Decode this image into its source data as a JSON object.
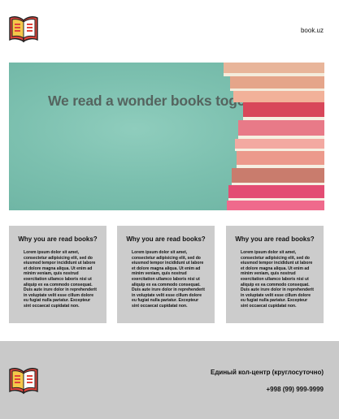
{
  "header": {
    "site_link": "book.uz",
    "logo_icon": "open-book-icon"
  },
  "hero": {
    "title": "We read a wonder books together..."
  },
  "cards": [
    {
      "title": "Why you are read books?",
      "text": "Lorem ipsum dolor sit amet, consectetur adipisicing elit, sed do eiusmod tempor incididunt ut labore et dolore magna aliqua. Ut enim ad minim veniam, quis nostrud exercitation ullamco laboris nisi ut aliquip ex ea commodo consequat. Duis aute irure dolor in reprehenderit in voluptate velit esse cillum dolore eu fugiat nulla pariatur. Excepteur sint occaecat cupidatat non."
    },
    {
      "title": "Why you are read books?",
      "text": "Lorem ipsum dolor sit amet, consectetur adipisicing elit, sed do eiusmod tempor incididunt ut labore et dolore magna aliqua. Ut enim ad minim veniam, quis nostrud exercitation ullamco laboris nisi ut aliquip ex ea commodo consequat. Duis aute irure dolor in reprehenderit in voluptate velit esse cillum dolore eu fugiat nulla pariatur. Excepteur sint occaecat cupidatat non."
    },
    {
      "title": "Why you are read books?",
      "text": "Lorem ipsum dolor sit amet, consectetur adipisicing elit, sed do eiusmod tempor incididunt ut labore et dolore magna aliqua. Ut enim ad minim veniam, quis nostrud exercitation ullamco laboris nisi ut aliquip ex ea commodo consequat. Duis aute irure dolor in reprehenderit in voluptate velit esse cillum dolore eu fugiat nulla pariatur. Excepteur sint occaecat cupidatat non."
    }
  ],
  "footer": {
    "call_center": "Единый кол-центр (круглосуточно)",
    "phone": "+998 (99) 999-9999",
    "logo_icon": "open-book-icon"
  },
  "colors": {
    "card_bg": "#cccccc",
    "footer_bg": "#c9c9c9",
    "hero_bg": "#7cc0af",
    "logo_red": "#e0443b",
    "logo_yellow": "#f5c84a"
  }
}
